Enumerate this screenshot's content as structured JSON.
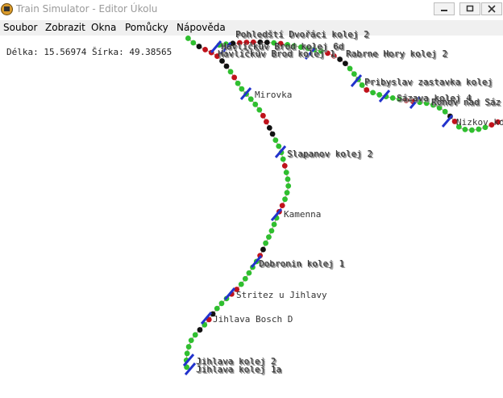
{
  "window": {
    "title": "Train Simulator - Editor Úkolu",
    "icon": "app-icon",
    "buttons": [
      "minimize-icon",
      "maximize-icon",
      "close-icon"
    ]
  },
  "menu": [
    "Soubor",
    "Zobrazit",
    "Okna",
    "Pomůcky",
    "Nápověda"
  ],
  "status": {
    "coords": "Délka: 15.56974 Šírka: 49.38565"
  },
  "stations": [
    "Pohledští Dvořáci kolej 2",
    "Havlíčkův Brod kolej 6d",
    "Havlíčkův Brod kolej 1",
    "Rabrne Hory kolej 2",
    "Pribyslav zastavka kolej",
    "Sázava kolej 4",
    "Ronov nad Sáz",
    "Nizkov ko",
    "Mirovka",
    "Slapanov kolej 2",
    "Kamenna",
    "Dobronin kolej 1",
    "Stritez u Jihlavy",
    "Jihlava Bosch D",
    "Jihlava kolej 2",
    "Jihlava kolej 1a"
  ],
  "colors": {
    "track_green": "#2fbf2f",
    "signal_red": "#c0121b",
    "signal_black": "#111111",
    "station_blue": "#2233cc",
    "line": "#b08b8b"
  }
}
